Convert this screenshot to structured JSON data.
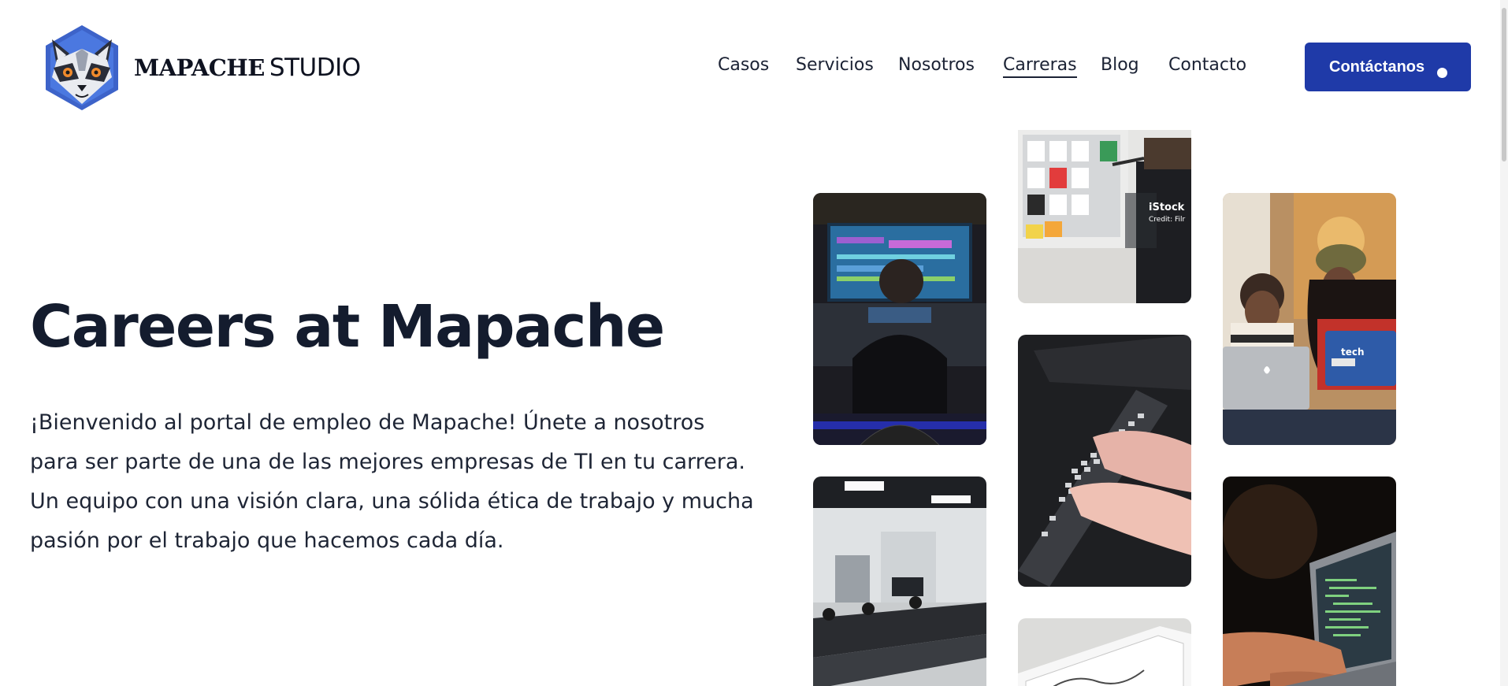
{
  "brand": {
    "name_bold": "MAPACHE",
    "name_light": "STUDIO"
  },
  "nav": {
    "items": [
      "Casos",
      "Servicios",
      "Nosotros",
      "Carreras",
      "Blog",
      "Contacto"
    ],
    "active": "Carreras",
    "cta_label": "Contáctanos"
  },
  "hero": {
    "title": "Careers at Mapache",
    "text": "¡Bienvenido al portal de empleo de Mapache! Únete a nosotros para ser parte de una de las mejores empresas de TI en tu carrera. Un equipo con una visión clara, una sólida ética de trabajo y mucha pasión por el trabajo que hacemos cada día."
  },
  "photos": {
    "watermark_line1": "iStock",
    "watermark_line2": "Credit: Filr",
    "laptop_sticker": "tech"
  },
  "colors": {
    "accent": "#1f3aa8",
    "text": "#141c2e"
  }
}
